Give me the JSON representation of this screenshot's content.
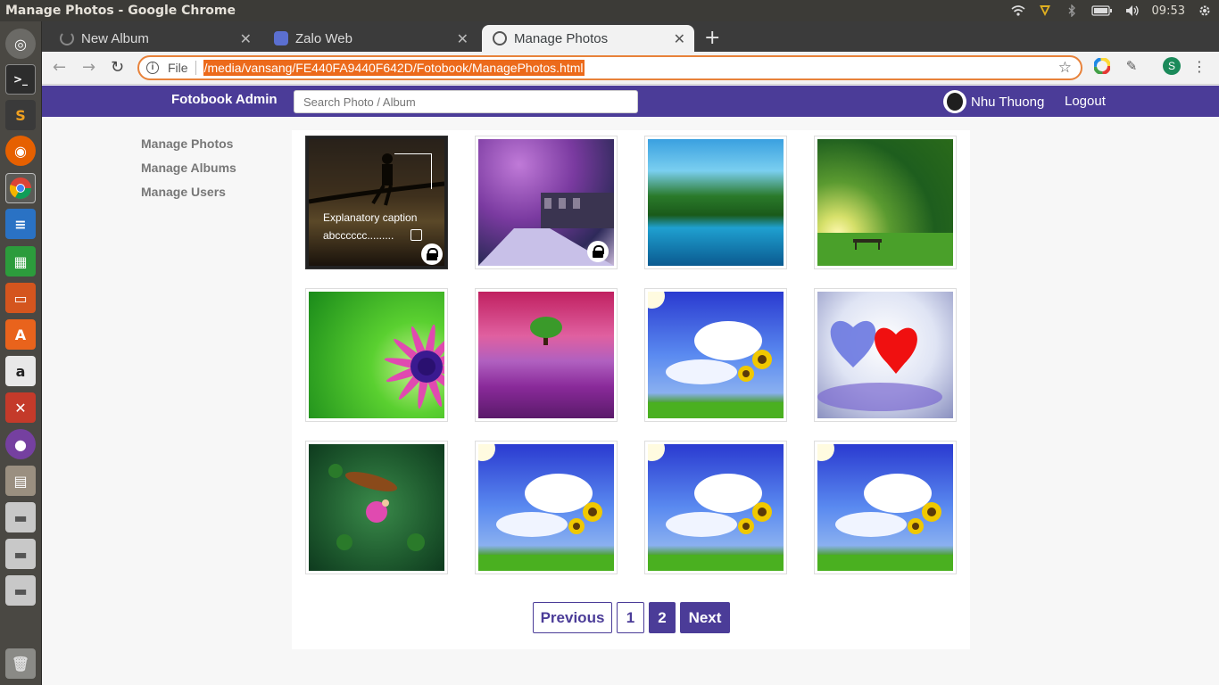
{
  "window": {
    "title": "Manage Photos - Google Chrome",
    "clock": "09:53"
  },
  "browser": {
    "tabs": [
      {
        "label": "New Album"
      },
      {
        "label": "Zalo Web"
      },
      {
        "label": "Manage Photos"
      }
    ],
    "address": {
      "scheme_label": "File",
      "url": "/media/vansang/FE440FA9440F642D/Fotobook/ManagePhotos.html"
    },
    "profile_initial": "S"
  },
  "header": {
    "brand": "Fotobook Admin",
    "search_placeholder": "Search Photo / Album",
    "user_name": "Nhu Thuong",
    "logout": "Logout"
  },
  "sidebar": {
    "items": [
      {
        "label": "Manage Photos"
      },
      {
        "label": "Manage Albums"
      },
      {
        "label": "Manage Users"
      }
    ]
  },
  "gallery": {
    "hover_caption": {
      "line1": "Explanatory caption",
      "line2": "abcccccc........."
    },
    "photos": [
      {
        "subject": "man sitting on tree branch",
        "locked": true
      },
      {
        "subject": "purple blossom garden path",
        "locked": true
      },
      {
        "subject": "lake with green trees",
        "locked": false
      },
      {
        "subject": "tree and bench at sunset",
        "locked": false
      },
      {
        "subject": "pink daisy flower",
        "locked": false
      },
      {
        "subject": "lavender field with tree",
        "locked": false
      },
      {
        "subject": "sunflowers and blue sky",
        "locked": false
      },
      {
        "subject": "red and blue hearts in snow",
        "locked": false
      },
      {
        "subject": "boat on lotus pond",
        "locked": false
      },
      {
        "subject": "sunflowers and blue sky",
        "locked": false
      },
      {
        "subject": "sunflowers and blue sky",
        "locked": false
      },
      {
        "subject": "sunflowers and blue sky",
        "locked": false
      }
    ]
  },
  "pagination": {
    "previous": "Previous",
    "pages": [
      "1",
      "2"
    ],
    "current": "2",
    "next": "Next"
  },
  "colors": {
    "primary": "#4b3c98",
    "omnibox_focus": "#e8823a"
  }
}
